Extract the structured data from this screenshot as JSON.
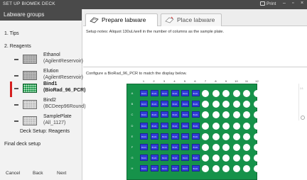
{
  "window": {
    "title": "SET UP BIOMEK DECK",
    "print_label": "Print",
    "minimize": "–",
    "restore": "▫",
    "close": "×"
  },
  "left_panel": {
    "header": "Labware groups",
    "tips": "1. Tips",
    "reagents": "2. Reagents",
    "items": [
      {
        "name": "Ethanol",
        "sub": "(AgilentReservoir)",
        "thumb": "grey"
      },
      {
        "name": "Elution",
        "sub": "(AgilentReservoir)",
        "thumb": "grey"
      },
      {
        "name": "Bind1",
        "sub": "(BioRad_96_PCR)",
        "thumb": "green",
        "active": true
      },
      {
        "name": "Bind2",
        "sub": "(BCDeep96Round)",
        "thumb": "light"
      },
      {
        "name": "SamplePlate",
        "sub": "(All_1127)",
        "thumb": "light"
      }
    ],
    "deck_setup": "Deck Setup: Reagents",
    "final_setup": "Final deck setup",
    "buttons": {
      "cancel": "Cancel",
      "back": "Back",
      "next": "Next"
    }
  },
  "tabs": {
    "prepare": "Prepare labware",
    "place": "Place labware"
  },
  "notes": "Setup notes:  Aliquot 130uL/well in the number of columns as the sample plate.",
  "configure": "Configure a BioRad_96_PCR to match the display below.",
  "plate": {
    "columns": [
      "1",
      "2",
      "3",
      "4",
      "5",
      "6",
      "7",
      "8",
      "9",
      "10",
      "11",
      "12"
    ],
    "rows": [
      "A",
      "B",
      "C",
      "D",
      "E",
      "F",
      "G",
      "H"
    ],
    "filled_columns": 6,
    "filled_label": "Bind1",
    "colors": {
      "plate": "#16924a",
      "filled": "#2f3cd8",
      "empty": "#ffffff"
    }
  },
  "side": {
    "zoom_label": "1:1"
  }
}
